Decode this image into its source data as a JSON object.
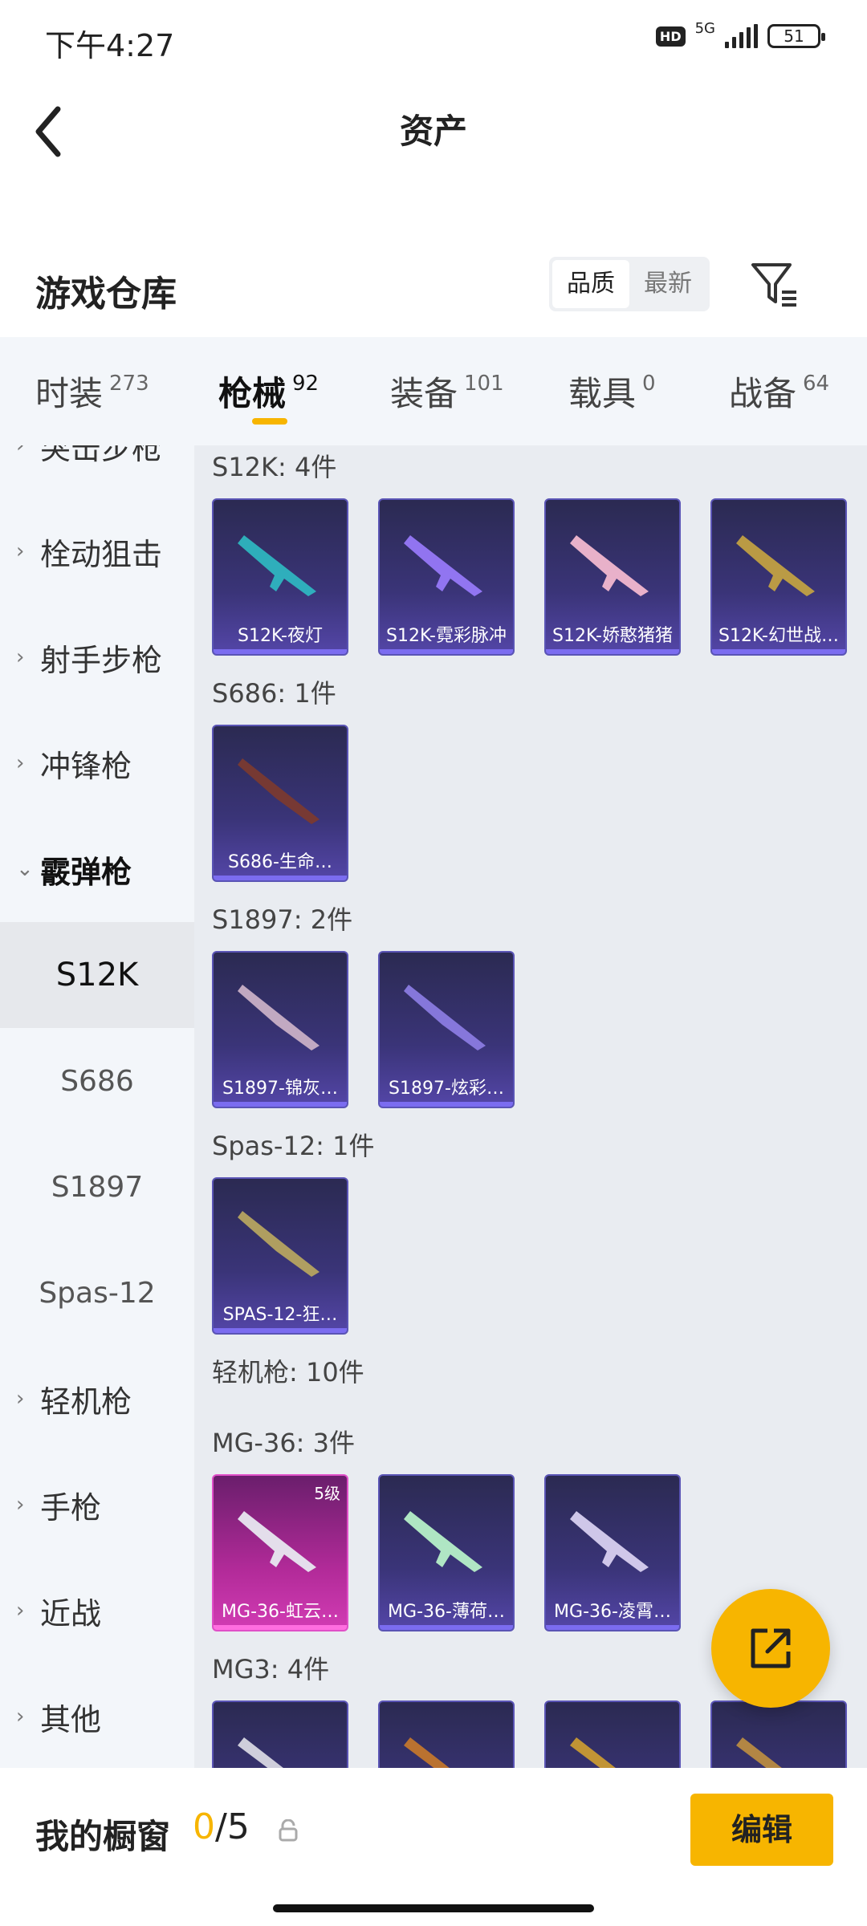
{
  "status": {
    "time": "下午4:27",
    "hd": "HD",
    "network": "5G",
    "battery": "51"
  },
  "nav": {
    "title": "资产",
    "back_icon": "chevron-left-icon"
  },
  "warehouse": {
    "title": "游戏仓库",
    "sort_options": [
      "品质",
      "最新"
    ],
    "active_sort": "品质",
    "filter_icon": "filter-icon"
  },
  "tabs": [
    {
      "label": "时装",
      "count": "273"
    },
    {
      "label": "枪械",
      "count": "92",
      "active": true
    },
    {
      "label": "装备",
      "count": "101"
    },
    {
      "label": "载具",
      "count": "0"
    },
    {
      "label": "战备",
      "count": "64"
    }
  ],
  "sidebar": {
    "categories": [
      {
        "label": "突击步枪"
      },
      {
        "label": "栓动狙击"
      },
      {
        "label": "射手步枪"
      },
      {
        "label": "冲锋枪"
      },
      {
        "label": "霰弹枪",
        "expanded": true
      },
      {
        "label": "轻机枪"
      },
      {
        "label": "手枪"
      },
      {
        "label": "近战"
      },
      {
        "label": "其他"
      }
    ],
    "subitems": [
      {
        "label": "S12K",
        "active": true
      },
      {
        "label": "S686"
      },
      {
        "label": "S1897"
      },
      {
        "label": "Spas-12"
      }
    ]
  },
  "groups": [
    {
      "title": "S12K: 4件",
      "items": [
        {
          "name": "S12K-夜灯"
        },
        {
          "name": "S12K-霓彩脉冲"
        },
        {
          "name": "S12K-娇憨猪猪"
        },
        {
          "name": "S12K-幻世战…"
        }
      ]
    },
    {
      "title": "S686: 1件",
      "items": [
        {
          "name": "S686-生命…"
        }
      ]
    },
    {
      "title": "S1897: 2件",
      "items": [
        {
          "name": "S1897-锦灰…"
        },
        {
          "name": "S1897-炫彩…"
        }
      ]
    },
    {
      "title": "Spas-12: 1件",
      "items": [
        {
          "name": "SPAS-12-狂…"
        }
      ]
    },
    {
      "title": "轻机枪: 10件",
      "items": []
    },
    {
      "title": "MG-36: 3件",
      "items": [
        {
          "name": "MG-36-虹云…",
          "level": "5级",
          "rarity": "pink"
        },
        {
          "name": "MG-36-薄荷…"
        },
        {
          "name": "MG-36-凌霄…"
        }
      ]
    },
    {
      "title": "MG3: 4件",
      "items": [
        {
          "name": ""
        },
        {
          "name": ""
        },
        {
          "name": ""
        },
        {
          "name": ""
        }
      ]
    }
  ],
  "showcase": {
    "label": "我的橱窗",
    "current": "0",
    "total": "/5",
    "edit_label": "编辑"
  },
  "colors": {
    "accent": "#f7b500",
    "card_bg": "#3a3478",
    "sidebar_bg": "#f3f6fa",
    "content_bg": "#e9ecf1"
  }
}
